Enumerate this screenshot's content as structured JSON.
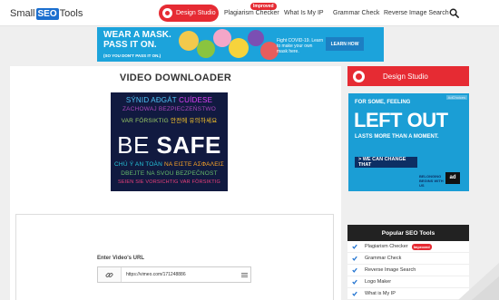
{
  "header": {
    "logo": {
      "prefix": "Small",
      "highlight": "SEO",
      "suffix": "Tools"
    },
    "nav": {
      "design_studio": "Design Studio",
      "plagiarism_checker": "Plagiarism Checker",
      "improved_badge": "Improved",
      "what_is_my_ip": "What Is My IP",
      "grammar_check": "Grammar Check",
      "reverse_image_search": "Reverse Image Search"
    },
    "search_icon": "search-icon"
  },
  "ad_top": {
    "line1": "WEAR A MASK.",
    "line2": "PASS IT ON.",
    "tagline": "(SO YOU DON'T PASS IT ON.)",
    "message": "Fight COVID-19. Learn to make your own mask here.",
    "cta": "LEARN HOW"
  },
  "main": {
    "title": "VIDEO DOWNLOADER",
    "poster": {
      "lines_top": [
        "SÝNID AÐGÁT",
        "CUÍDESE",
        "ZACHOWAJ BEZPIECZEŃSTWO",
        "VAR FÖRSIKTIG",
        "안전에 유의하세요"
      ],
      "headline_light": "BE ",
      "headline_bold": "SAFE",
      "lines_bottom": [
        "CHÚ Ý AN TOÀN",
        "ΝΑ ΕΙΣΤΕ ΑΣΦΑΛΕΙΣ",
        "DBEJTE NA SVOU BEZPEČNOST",
        "SEIEN SIE VORSICHTIG VAR FÖRSIKTIG"
      ]
    },
    "form": {
      "label": "Enter Video's URL",
      "url_value": "https://vimeo.com/171248886"
    }
  },
  "sidebar": {
    "design_studio": "Design Studio",
    "ad": {
      "line1": "FOR SOME, FEELING",
      "line2": "LEFT OUT",
      "line3": "LASTS MORE THAN A MOMENT.",
      "cta": "> WE CAN CHANGE THAT",
      "org": "BELONGING BEGINS WITH US",
      "ad_logo": "ad",
      "adchoices": "AdChoices"
    },
    "tools": {
      "heading": "Popular SEO Tools",
      "items": [
        {
          "label": "Plagiarism Checker",
          "badge": "Improved"
        },
        {
          "label": "Grammar Check",
          "badge": ""
        },
        {
          "label": "Reverse Image Search",
          "badge": ""
        },
        {
          "label": "Logo Maker",
          "badge": ""
        },
        {
          "label": "What is My IP",
          "badge": ""
        }
      ]
    }
  },
  "colors": {
    "accent": "#e62b33",
    "brand_blue": "#1b6fcf",
    "ad_blue": "#1ca3db"
  }
}
